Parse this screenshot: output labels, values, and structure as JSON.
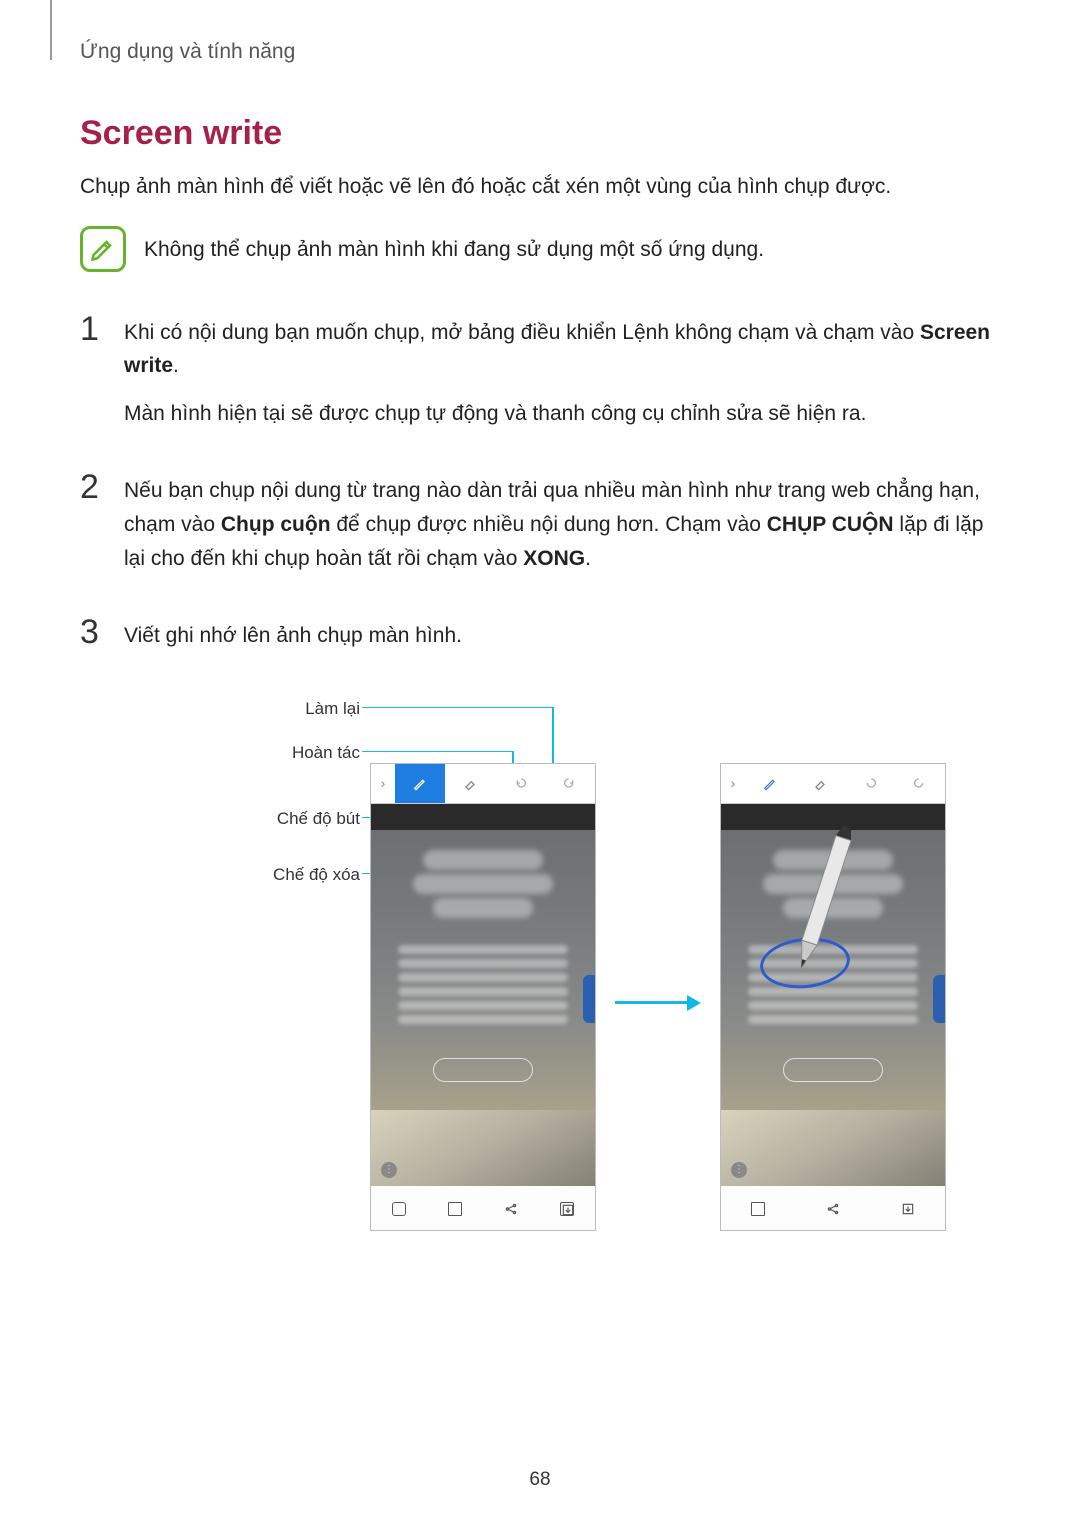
{
  "breadcrumb": "Ứng dụng và tính năng",
  "title": "Screen write",
  "intro": "Chụp ảnh màn hình để viết hoặc vẽ lên đó hoặc cắt xén một vùng của hình chụp được.",
  "note": "Không thể chụp ảnh màn hình khi đang sử dụng một số ứng dụng.",
  "steps": {
    "s1": {
      "num": "1",
      "part_a": "Khi có nội dung bạn muốn chụp, mở bảng điều khiển Lệnh không chạm và chạm vào ",
      "bold_a": "Screen write",
      "part_b": ".",
      "line2": "Màn hình hiện tại sẽ được chụp tự động và thanh công cụ chỉnh sửa sẽ hiện ra."
    },
    "s2": {
      "num": "2",
      "part_a": "Nếu bạn chụp nội dung từ trang nào dàn trải qua nhiều màn hình như trang web chẳng hạn, chạm vào ",
      "bold_a": "Chụp cuộn",
      "part_b": " để chụp được nhiều nội dung hơn. Chạm vào ",
      "bold_b": "CHỤP CUỘN",
      "part_c": " lặp đi lặp lại cho đến khi chụp hoàn tất rồi chạm vào ",
      "bold_c": "XONG",
      "part_d": "."
    },
    "s3": {
      "num": "3",
      "text": "Viết ghi nhớ lên ảnh chụp màn hình."
    }
  },
  "callouts": {
    "redo": "Làm lại",
    "undo": "Hoàn tác",
    "pen_mode": "Chế độ bút",
    "erase_mode": "Chế độ xóa"
  },
  "page_number": "68"
}
